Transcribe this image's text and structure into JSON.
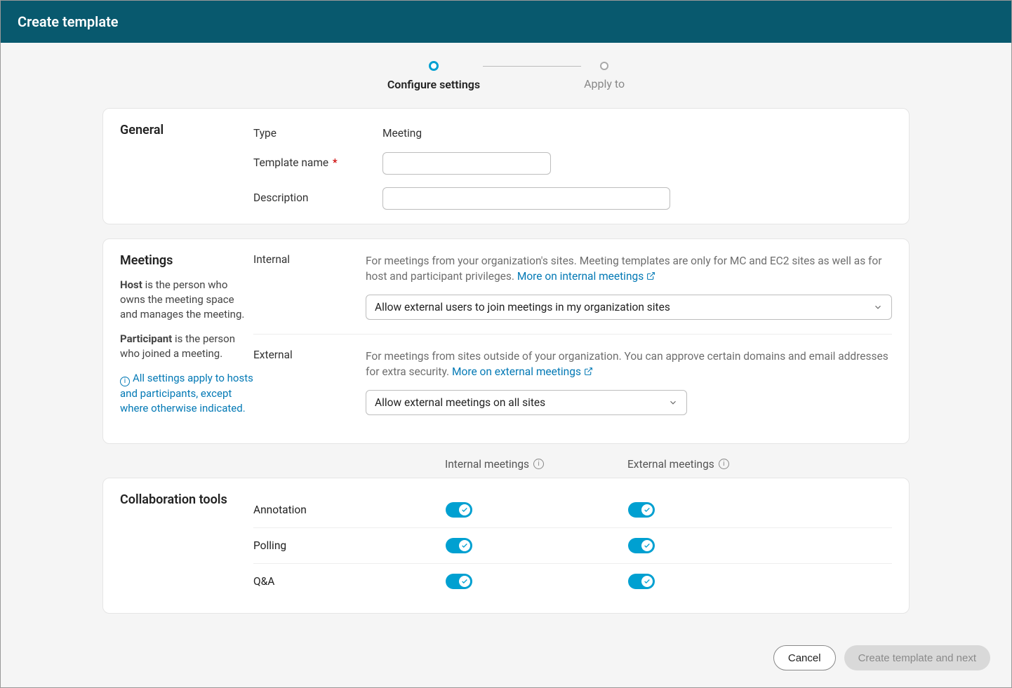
{
  "header": {
    "title": "Create template"
  },
  "stepper": {
    "step1": "Configure settings",
    "step2": "Apply to"
  },
  "general": {
    "title": "General",
    "type_label": "Type",
    "type_value": "Meeting",
    "name_label": "Template name",
    "name_value": "",
    "desc_label": "Description",
    "desc_value": ""
  },
  "meetings": {
    "title": "Meetings",
    "host_bold": "Host",
    "host_rest": " is the person who owns the meeting space and manages the meeting.",
    "participant_bold": "Participant",
    "participant_rest": " is the person who joined a meeting.",
    "note": "All settings apply to hosts and participants, except where otherwise indicated.",
    "internal": {
      "label": "Internal",
      "desc": "For meetings from your organization's sites. Meeting templates are only for MC and EC2 sites as well as for host and participant privileges. ",
      "link": "More on internal meetings",
      "select": "Allow external users to join meetings in my organization sites"
    },
    "external": {
      "label": "External",
      "desc": "For meetings from sites outside of your organization. You can approve certain domains and email addresses for extra security. ",
      "link": "More on external meetings",
      "select": "Allow external meetings on all sites"
    }
  },
  "collab": {
    "header_internal": "Internal meetings",
    "header_external": "External meetings",
    "title": "Collaboration tools",
    "rows": {
      "annotation": "Annotation",
      "polling": "Polling",
      "qa": "Q&A"
    }
  },
  "footer": {
    "cancel": "Cancel",
    "next": "Create template and next"
  }
}
